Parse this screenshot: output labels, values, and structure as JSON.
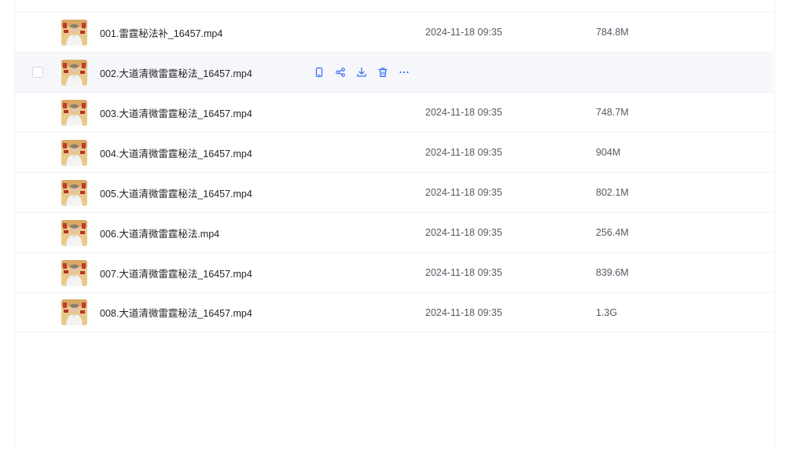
{
  "colors": {
    "accent": "#3b6ff5",
    "row_hover_bg": "#f5f7fb",
    "divider": "#f1f2f5"
  },
  "files": [
    {
      "name": "001.雷霆秘法补_16457.mp4",
      "date": "2024-11-18 09:35",
      "size": "784.8M",
      "hovered": false
    },
    {
      "name": "002.大道清微雷霆秘法_16457.mp4",
      "date": "",
      "size": "",
      "hovered": true
    },
    {
      "name": "003.大道清微雷霆秘法_16457.mp4",
      "date": "2024-11-18 09:35",
      "size": "748.7M",
      "hovered": false
    },
    {
      "name": "004.大道清微雷霆秘法_16457.mp4",
      "date": "2024-11-18 09:35",
      "size": "904M",
      "hovered": false
    },
    {
      "name": "005.大道清微雷霆秘法_16457.mp4",
      "date": "2024-11-18 09:35",
      "size": "802.1M",
      "hovered": false
    },
    {
      "name": "006.大道清微雷霆秘法.mp4",
      "date": "2024-11-18 09:35",
      "size": "256.4M",
      "hovered": false
    },
    {
      "name": "007.大道清微雷霆秘法_16457.mp4",
      "date": "2024-11-18 09:35",
      "size": "839.6M",
      "hovered": false
    },
    {
      "name": "008.大道清微雷霆秘法_16457.mp4",
      "date": "2024-11-18 09:35",
      "size": "1.3G",
      "hovered": false
    }
  ],
  "hover_actions": [
    {
      "icon": "phone-icon"
    },
    {
      "icon": "share-icon"
    },
    {
      "icon": "download-icon"
    },
    {
      "icon": "trash-icon"
    },
    {
      "icon": "more-icon"
    }
  ]
}
